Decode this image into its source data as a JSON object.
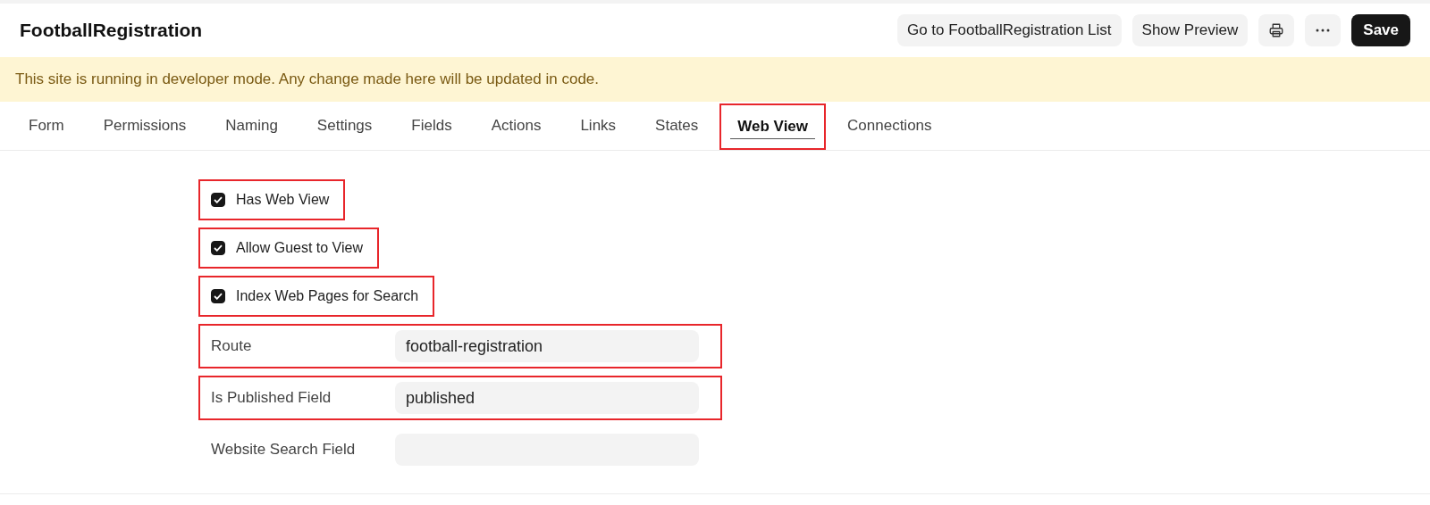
{
  "header": {
    "title": "FootballRegistration",
    "buttons": [
      {
        "kind": "text",
        "label": "Go to FootballRegistration List"
      },
      {
        "kind": "text",
        "label": "Show Preview"
      },
      {
        "kind": "print"
      },
      {
        "kind": "more"
      },
      {
        "kind": "primary",
        "label": "Save"
      }
    ]
  },
  "banner": "This site is running in developer mode. Any change made here will be updated in code.",
  "tabs": [
    {
      "label": "Form",
      "selected": false,
      "highlighted": false
    },
    {
      "label": "Permissions",
      "selected": false,
      "highlighted": false
    },
    {
      "label": "Naming",
      "selected": false,
      "highlighted": false
    },
    {
      "label": "Settings",
      "selected": false,
      "highlighted": false
    },
    {
      "label": "Fields",
      "selected": false,
      "highlighted": false
    },
    {
      "label": "Actions",
      "selected": false,
      "highlighted": false
    },
    {
      "label": "Links",
      "selected": false,
      "highlighted": false
    },
    {
      "label": "States",
      "selected": false,
      "highlighted": false
    },
    {
      "label": "Web View",
      "selected": true,
      "highlighted": true
    },
    {
      "label": "Connections",
      "selected": false,
      "highlighted": false
    }
  ],
  "fields": [
    {
      "kind": "checkbox",
      "label": "Has Web View",
      "checked": true,
      "highlighted": true
    },
    {
      "kind": "checkbox",
      "label": "Allow Guest to View",
      "checked": true,
      "highlighted": true
    },
    {
      "kind": "checkbox",
      "label": "Index Web Pages for Search",
      "checked": true,
      "highlighted": true
    },
    {
      "kind": "text",
      "label": "Route",
      "value": "football-registration",
      "highlighted": true
    },
    {
      "kind": "text",
      "label": "Is Published Field",
      "value": "published",
      "highlighted": true
    },
    {
      "kind": "text",
      "label": "Website Search Field",
      "highlighted": false
    }
  ]
}
